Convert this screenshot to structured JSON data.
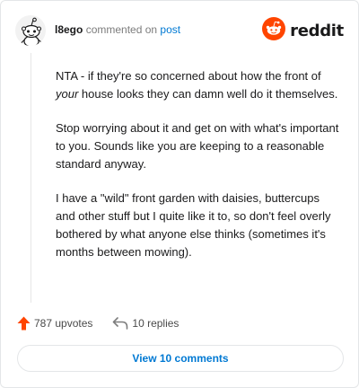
{
  "header": {
    "username": "l8ego",
    "action_text": "commented on",
    "post_link": "post",
    "logo_word": "reddit"
  },
  "comment": {
    "paragraph_1_before": "NTA - if they're so concerned about how the front of ",
    "paragraph_1_emphasis": "your",
    "paragraph_1_after": " house looks they can damn well do it themselves.",
    "paragraph_2": "Stop worrying about it and get on with what's important to you. Sounds like you are keeping to a reasonable standard anyway.",
    "paragraph_3": "I have a \"wild\" front garden with daisies, buttercups and other stuff but I quite like it to, so don't feel overly bothered by what anyone else thinks (sometimes it's months between mowing)."
  },
  "actions": {
    "upvotes_label": "787 upvotes",
    "replies_label": "10 replies"
  },
  "view_comments_label": "View 10 comments",
  "colors": {
    "accent_blue": "#0079d3",
    "upvote_orange": "#ff4500",
    "text": "#1a1a1b",
    "muted": "#7c7c7c",
    "border": "#e4e6e8"
  },
  "icons": {
    "avatar": "snoo-avatar-icon",
    "logo": "reddit-snoo-icon",
    "upvote": "upvote-arrow-icon",
    "reply": "reply-arrow-icon"
  }
}
